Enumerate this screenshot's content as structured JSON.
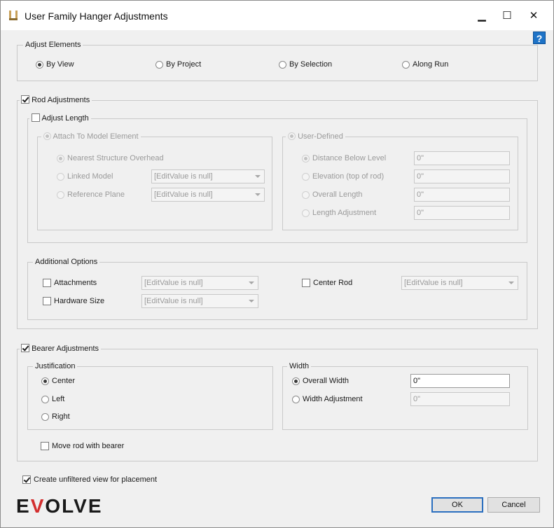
{
  "window": {
    "title": "User Family Hanger Adjustments",
    "controls": {
      "minimize": "▁",
      "maximize": "☐",
      "close": "✕"
    },
    "help_label": "?"
  },
  "adjust_elements": {
    "legend": "Adjust Elements",
    "options": [
      "By View",
      "By Project",
      "By Selection",
      "Along Run"
    ],
    "selected": "By View"
  },
  "rod": {
    "label": "Rod Adjustments",
    "checked": true,
    "adjust_length": {
      "label": "Adjust Length",
      "checked": false,
      "attach": {
        "legend": "Attach To Model Element",
        "nearest": "Nearest Structure Overhead",
        "linked": "Linked Model",
        "linked_value": "[EditValue is null]",
        "plane": "Reference Plane",
        "plane_value": "[EditValue is null]"
      },
      "user": {
        "legend": "User-Defined",
        "distance": "Distance Below Level",
        "distance_value": "0\"",
        "elevation": "Elevation (top of rod)",
        "elevation_value": "0\"",
        "overall": "Overall Length",
        "overall_value": "0\"",
        "adjustment": "Length Adjustment",
        "adjustment_value": "0\""
      }
    },
    "additional": {
      "legend": "Additional Options",
      "attachments": "Attachments",
      "attachments_value": "[EditValue is null]",
      "hardware": "Hardware Size",
      "hardware_value": "[EditValue is null]",
      "center_rod": "Center Rod",
      "center_rod_value": "[EditValue is null]"
    }
  },
  "bearer": {
    "label": "Bearer Adjustments",
    "checked": true,
    "justification": {
      "legend": "Justification",
      "options": [
        "Center",
        "Left",
        "Right"
      ],
      "selected": "Center"
    },
    "width": {
      "legend": "Width",
      "overall": "Overall Width",
      "overall_value": "0\"",
      "adjustment": "Width Adjustment",
      "adjustment_value": "0\""
    },
    "move_rod": "Move rod with bearer"
  },
  "create_view": {
    "label": "Create unfiltered view for placement",
    "checked": true
  },
  "logo": {
    "text_a": "E",
    "text_b": "V",
    "text_c": "OLVE"
  },
  "buttons": {
    "ok": "OK",
    "cancel": "Cancel"
  },
  "colors": {
    "accent": "#2b6fbf",
    "help": "#1e73c7",
    "logo_red": "#d32f2f"
  }
}
